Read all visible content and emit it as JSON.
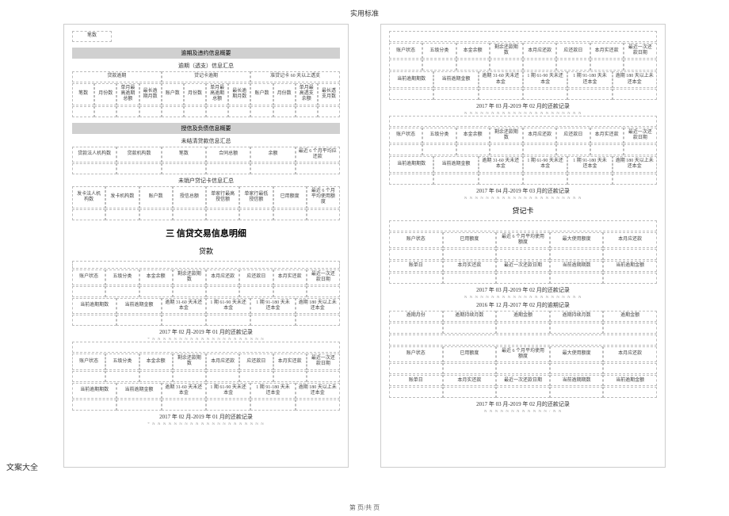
{
  "doc": {
    "header": "实用标准",
    "footer": "文案大全",
    "pagenum": "第 页/共 页"
  },
  "left": {
    "top1": "笔数",
    "band1": "逾期及违约信息概要",
    "sub1": "逾期（透支）信息汇总",
    "r1": {
      "a": "贷款逾期",
      "b": "贷记卡逾期",
      "c": "准贷记卡 60 天以上透支"
    },
    "r2": {
      "a": "笔数",
      "b": "月份数",
      "c": "单月最高逾期总额",
      "d": "最长逾期月数",
      "e": "账户数",
      "f": "月份数",
      "g": "单月最高逾期总额",
      "h": "最长逾期月数",
      "i": "账户数",
      "j": "月份数",
      "k": "单月最高透支余额",
      "l": "最长透支月数"
    },
    "band2": "授信及负债信息概要",
    "sub2": "未结清贷款信息汇总",
    "r3": {
      "a": "贷款法人机构数",
      "b": "贷款机构数",
      "c": "笔数",
      "d": "合同总额",
      "e": "余额",
      "f": "最近 6 个月平均应还款"
    },
    "sub3": "未销户贷记卡信息汇总",
    "r4": {
      "a": "发卡法人机构数",
      "b": "发卡机构数",
      "c": "账户数",
      "d": "授信总额",
      "e": "单家行最高授信额",
      "f": "单家行最低授信额",
      "g": "已用额度",
      "h": "最近 6 个月平均使用额度"
    },
    "title": "三 信贷交易信息明细",
    "subtitle": "贷款",
    "b1": {
      "a": "账户状态",
      "b": "五级分类",
      "c": "本金余额",
      "d": "剩余还款期数",
      "e": "本月应还款",
      "f": "应还款日",
      "g": "本月实还款",
      "h": "最近一次还款日期"
    },
    "b2": {
      "a": "当前逾期期数",
      "b": "当前逾期金额",
      "c": "逾期 31-60 天未还本金",
      "d": "1 期 61-90 天未还本金",
      "e": "1 期 91-180 天未还本金",
      "f": "逾期 180 天以上未还本金"
    },
    "rec1": "2017 年 02 月-2019 年 01 月的还款记录",
    "nrow": "* N N N N N N N N N N N N N N N N N N N N N",
    "b3": {
      "a": "账户状态",
      "b": "五级分类",
      "c": "本金余额",
      "d": "剩余还款期数",
      "e": "本月应还款",
      "f": "应还款日",
      "g": "本月实还款",
      "h": "最近一次还款日期"
    },
    "b4": {
      "a": "当前逾期期数",
      "b": "当前逾期金额",
      "c": "逾期 31-60 天未还本金",
      "d": "1 期 61-90 天未还本金",
      "e": "1 期 91-180 天未还本金",
      "f": "逾期 180 天以上未还本金"
    },
    "rec2": "2017 年 02 月-2019 年 01 月的还款记录"
  },
  "right": {
    "r1": {
      "a": "账户状态",
      "b": "五级分类",
      "c": "本金余额",
      "d": "剩余还款期数",
      "e": "本月应还款",
      "f": "应还款日",
      "g": "本月实还款",
      "h": "最近一次还款日期"
    },
    "r2": {
      "a": "当前逾期期数",
      "b": "当前逾期金额",
      "c": "逾期 31-60 天未还本金",
      "d": "1 期 61-90 天未还本金",
      "e": "1 期 91-180 天未还本金",
      "f": "逾期 180 天以上未还本金"
    },
    "rec1": "2017 年 03 月-2019 年 02 月的还款记录",
    "r3": {
      "a": "账户状态",
      "b": "五级分类",
      "c": "本金余额",
      "d": "剩余还款期数",
      "e": "本月应还款",
      "f": "应还款日",
      "g": "本月实还款",
      "h": "最近一次还款日期"
    },
    "r4": {
      "a": "当前逾期期数",
      "b": "当前逾期金额",
      "c": "逾期 31-60 天未还本金",
      "d": "1 期 61-90 天未还本金",
      "e": "1 期 91-180 天未还本金",
      "f": "逾期 180 天以上未还本金"
    },
    "rec2": "2017 年 04 月-2019 年 03 月的还款记录",
    "nrow": "N N N N N N N N N N N N N N N N N N N N N N",
    "title2": "贷记卡",
    "c1": {
      "a": "账户状态",
      "b": "已用额度",
      "c": "最近 6 个月平均使用额度",
      "d": "最大使用额度",
      "e": "本月应还款"
    },
    "c2": {
      "a": "账单日",
      "b": "本月实还款",
      "c": "最近一次还款日期",
      "d": "当前逾期期数",
      "e": "当前逾期金额"
    },
    "rec3": "2017 年 03 月-2019 年 02 月的还款记录",
    "rec4": "2016 年 12 月-2017 年 02 月的逾期记录",
    "c3": {
      "a": "逾期月份",
      "b": "逾期持续月数",
      "c": "逾期金额",
      "d": "逾期持续月数",
      "e": "逾期金额"
    },
    "c4": {
      "a": "账户状态",
      "b": "已用额度",
      "c": "最近 6 个月平均使用额度",
      "d": "最大使用额度",
      "e": "本月应还款"
    },
    "c5": {
      "a": "账单日",
      "b": "本月实还款",
      "c": "最近一次还款日期",
      "d": "当前逾期期数",
      "e": "当前逾期金额"
    },
    "rec5": "2017 年 03 月-2019 年 02 月的还款记录",
    "nrow2": "N N N N N N N N N N N N / N N"
  }
}
